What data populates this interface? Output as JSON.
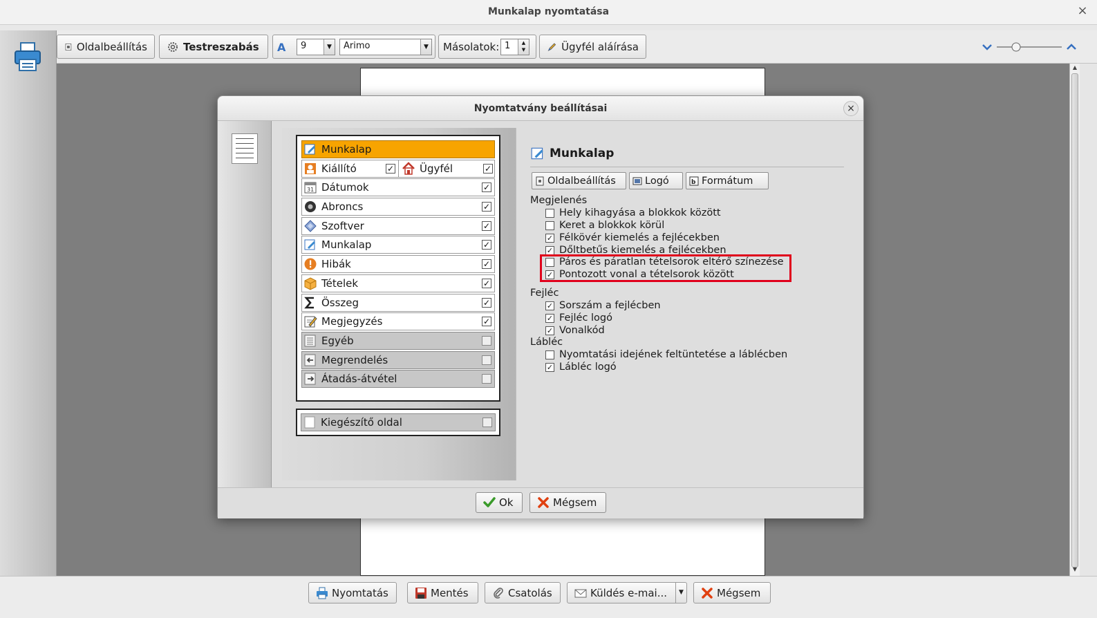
{
  "window": {
    "title": "Munkalap nyomtatása",
    "close_glyph": "×"
  },
  "toolbar": {
    "page_setup": "Oldalbeállítás",
    "customize": "Testreszabás",
    "font_size": "9",
    "font_name": "Arimo",
    "copies_label": "Másolatok:",
    "copies_value": "1",
    "client_sign": "Ügyfél aláírása"
  },
  "dialog": {
    "title": "Nyomtatvány beállításai",
    "close_glyph": "×",
    "sections": [
      {
        "label": "Munkalap",
        "icon": "worksheet-icon",
        "selected": true
      },
      {
        "label": "Kiállító",
        "icon": "issuer-icon",
        "checked": true,
        "right_label": "Ügyfél",
        "right_icon": "house-icon",
        "right_checked": true
      },
      {
        "label": "Dátumok",
        "icon": "calendar-icon",
        "checked": true
      },
      {
        "label": "Abroncs",
        "icon": "tire-icon",
        "checked": true
      },
      {
        "label": "Szoftver",
        "icon": "software-icon",
        "checked": true
      },
      {
        "label": "Munkalap",
        "icon": "worksheet-icon",
        "checked": true
      },
      {
        "label": "Hibák",
        "icon": "warning-icon",
        "checked": true
      },
      {
        "label": "Tételek",
        "icon": "box-icon",
        "checked": true
      },
      {
        "label": "Összeg",
        "icon": "sigma-icon",
        "checked": true
      },
      {
        "label": "Megjegyzés",
        "icon": "note-icon",
        "checked": true
      },
      {
        "label": "Egyéb",
        "icon": "list-icon",
        "checked": false,
        "disabled": true
      },
      {
        "label": "Megrendelés",
        "icon": "order-icon",
        "checked": false,
        "disabled": true
      },
      {
        "label": "Átadás-átvétel",
        "icon": "handover-icon",
        "checked": false,
        "disabled": true
      }
    ],
    "extra_page": {
      "label": "Kiegészítő oldal",
      "checked": false
    },
    "panel": {
      "title": "Munkalap",
      "buttons": {
        "page_setup": "Oldalbeállítás",
        "logo": "Logó",
        "format": "Formátum"
      },
      "groups": {
        "appearance": {
          "label": "Megjelenés",
          "options": [
            {
              "label": "Hely kihagyása a blokkok között",
              "checked": false
            },
            {
              "label": "Keret a blokkok körül",
              "checked": false
            },
            {
              "label": "Félkövér kiemelés a fejlécekben",
              "checked": true
            },
            {
              "label": "Dőltbetűs kiemelés a fejlécekben",
              "checked": true
            },
            {
              "label": "Páros és páratlan tételsorok eltérő színezése",
              "checked": false
            },
            {
              "label": "Pontozott vonal a tételsorok között",
              "checked": true
            }
          ]
        },
        "header": {
          "label": "Fejléc",
          "options": [
            {
              "label": "Sorszám a fejlécben",
              "checked": true
            },
            {
              "label": "Fejléc logó",
              "checked": true
            },
            {
              "label": "Vonalkód",
              "checked": true
            }
          ]
        },
        "footer": {
          "label": "Lábléc",
          "options": [
            {
              "label": "Nyomtatási idejének feltüntetése a láblécben",
              "checked": false
            },
            {
              "label": "Lábléc logó",
              "checked": true
            }
          ]
        }
      }
    },
    "ok": "Ok",
    "cancel": "Mégsem"
  },
  "bottom": {
    "print": "Nyomtatás",
    "save": "Mentés",
    "attach": "Csatolás",
    "send_email": "Küldés e-mai...",
    "cancel": "Mégsem"
  },
  "colors": {
    "selected_row": "#f7a400",
    "highlight": "#e0001b",
    "canvas": "#7e7e7e"
  }
}
